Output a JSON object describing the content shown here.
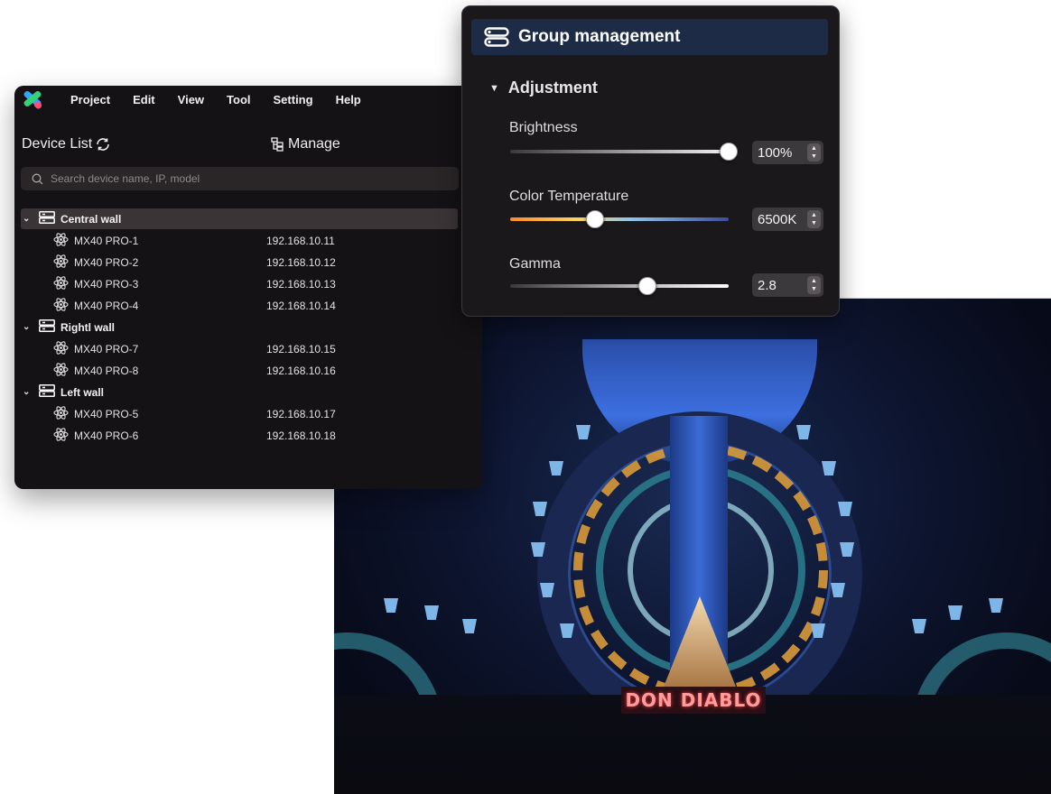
{
  "menu": {
    "items": [
      "Project",
      "Edit",
      "View",
      "Tool",
      "Setting",
      "Help"
    ]
  },
  "device_list": {
    "title": "Device List",
    "manage_label": "Manage",
    "search_placeholder": "Search device name, IP, model",
    "groups": [
      {
        "name": "Central wall",
        "selected": true,
        "devices": [
          {
            "name": "MX40 PRO-1",
            "ip": "192.168.10.11"
          },
          {
            "name": "MX40 PRO-2",
            "ip": "192.168.10.12"
          },
          {
            "name": "MX40 PRO-3",
            "ip": "192.168.10.13"
          },
          {
            "name": "MX40 PRO-4",
            "ip": "192.168.10.14"
          }
        ]
      },
      {
        "name": "Rightl wall",
        "selected": false,
        "devices": [
          {
            "name": "MX40 PRO-7",
            "ip": "192.168.10.15"
          },
          {
            "name": "MX40 PRO-8",
            "ip": "192.168.10.16"
          }
        ]
      },
      {
        "name": "Left wall",
        "selected": false,
        "devices": [
          {
            "name": "MX40 PRO-5",
            "ip": "192.168.10.17"
          },
          {
            "name": "MX40 PRO-6",
            "ip": "192.168.10.18"
          }
        ]
      }
    ]
  },
  "group_management": {
    "title": "Group management",
    "section": "Adjustment",
    "brightness": {
      "label": "Brightness",
      "value": "100%",
      "level": 1.0
    },
    "color_temperature": {
      "label": "Color Temperature",
      "value": "6500K",
      "level": 0.39
    },
    "gamma": {
      "label": "Gamma",
      "value": "2.8",
      "level": 0.63
    }
  },
  "stage_sign": "DON DIABLO",
  "colors": {
    "window_bg": "#151216",
    "panel_title_bg": "#1d2b47",
    "selected_row_bg": "#3a3436"
  }
}
